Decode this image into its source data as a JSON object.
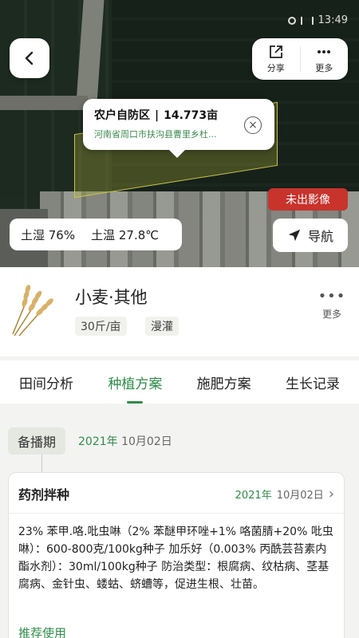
{
  "status_bar": {
    "time": "13:49"
  },
  "top_actions": {
    "share_label": "分享",
    "more_label": "更多"
  },
  "field_callout": {
    "name": "农户自防区",
    "area": "14.773亩",
    "address": "河南省周口市扶沟县曹里乡杜..."
  },
  "map": {
    "no_image_badge": "未出影像",
    "soil_moisture": "土湿 76%",
    "soil_temp": "土温 27.8℃",
    "navigate_label": "导航"
  },
  "crop": {
    "name": "小麦·其他",
    "tags": [
      "30斤/亩",
      "漫灌"
    ],
    "more_label": "更多"
  },
  "tabs": [
    "田间分析",
    "种植方案",
    "施肥方案",
    "生长记录"
  ],
  "active_tab": 1,
  "stage": {
    "label": "备播期",
    "date_year": "2021年",
    "date_rest": "10月02日"
  },
  "card": {
    "title": "药剂拌种",
    "date_year": "2021年",
    "date_rest": "10月02日",
    "body": "23% 苯甲.咯.吡虫啉（2% 苯醚甲环唑+1% 咯菌腈+20% 吡虫啉）：600-800克/100kg种子 加乐好（0.003% 丙酰芸苔素内酯水剂）：30ml/100kg种子 防治类型：根腐病、纹枯病、茎基腐病、金针虫、蝼蛄、蛴螬等，促进生根、壮苗。",
    "recommend_label": "推荐使用"
  },
  "colors": {
    "accent": "#2f8c4a",
    "badge_red": "#c8332c"
  }
}
